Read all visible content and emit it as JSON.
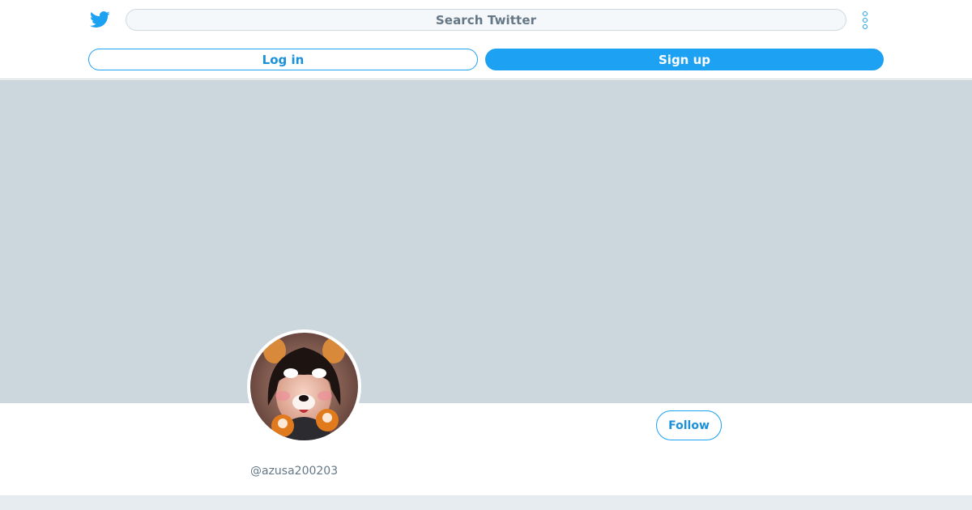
{
  "header": {
    "logo_icon": "twitter-bird-icon",
    "search_placeholder": "Search Twitter",
    "more_icon": "more-vertical-icon",
    "login_label": "Log in",
    "signup_label": "Sign up"
  },
  "profile": {
    "avatar_icon": "profile-photo",
    "follow_label": "Follow",
    "handle": "@azusa200203"
  },
  "colors": {
    "brand": "#1da1f2",
    "banner": "#ccd6dd",
    "secondary_text": "#657786"
  }
}
